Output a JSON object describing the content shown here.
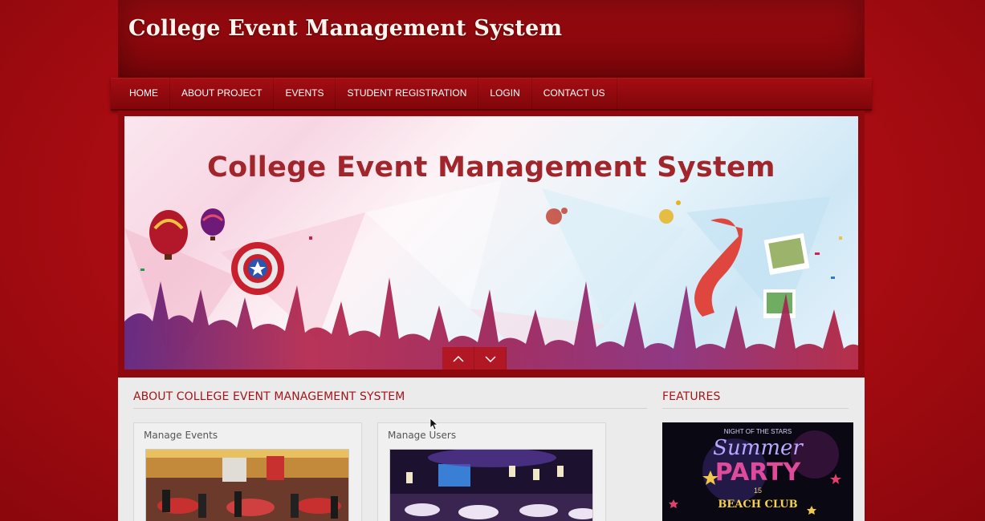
{
  "header": {
    "title": "College Event Management System"
  },
  "nav": {
    "items": [
      {
        "label": "HOME"
      },
      {
        "label": "ABOUT PROJECT"
      },
      {
        "label": "EVENTS"
      },
      {
        "label": "STUDENT REGISTRATION"
      },
      {
        "label": "LOGIN"
      },
      {
        "label": "CONTACT US"
      }
    ]
  },
  "banner": {
    "title": "College Event Management System",
    "prev_icon": "chevron-up-icon",
    "next_icon": "chevron-down-icon"
  },
  "about": {
    "heading": "ABOUT COLLEGE EVENT MANAGEMENT SYSTEM",
    "cards": [
      {
        "title": "Manage Events"
      },
      {
        "title": "Manage Users"
      }
    ]
  },
  "features": {
    "heading": "FEATURES",
    "poster": {
      "top_line": "NIGHT OF THE STARS",
      "script_line": "Summer",
      "main_line": "PARTY",
      "number": "15",
      "club_line": "BEACH CLUB"
    }
  },
  "colors": {
    "brand_red": "#a80c12",
    "heading_red": "#a41519",
    "banner_title": "#a0262c"
  }
}
